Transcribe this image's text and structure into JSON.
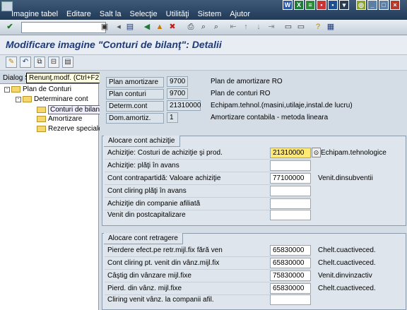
{
  "menu": {
    "items": [
      "Imagine tabel",
      "Editare",
      "Salt la",
      "Selecţie",
      "Utilităţi",
      "Sistem",
      "Ajutor"
    ]
  },
  "title": "Modificare imagine \"Conturi de bilanţ\": Detalii",
  "tooltip": "Renunţ.modf.  (Ctrl+F2)",
  "left": {
    "dialog_label": "Dialog S",
    "tree": [
      {
        "label": "Plan de Conturi",
        "level": 0
      },
      {
        "label": "Determinare cont",
        "level": 1
      },
      {
        "label": "Conturi de bilanţ",
        "level": 2
      },
      {
        "label": "Amortizare",
        "level": 2
      },
      {
        "label": "Rezerve speciale",
        "level": 2
      }
    ]
  },
  "header": {
    "plan_amort_label": "Plan amortizare",
    "plan_amort_value": "9700",
    "plan_amort_desc": "Plan de amortizare RO",
    "plan_conturi_label": "Plan conturi",
    "plan_conturi_value": "9700",
    "plan_conturi_desc": "Plan de conturi RO",
    "determ_label": "Determ.cont",
    "determ_value": "21310000",
    "determ_desc": "Echipam.tehnol.(masini,utilaje,instal.de lucru)",
    "dom_label": "Dom.amortiz.",
    "dom_value": "1",
    "dom_desc": "Amortizare contabila - metoda lineara"
  },
  "group1": {
    "title": "Alocare cont achiziţie",
    "rows": [
      {
        "label": "Achiziţie: Costuri de achiziţie şi prod.",
        "value": "21310000",
        "desc": "Echipam.tehnologice"
      },
      {
        "label": "Achiziţie: plăţi în avans",
        "value": "",
        "desc": ""
      },
      {
        "label": "Cont contrapartidă: Valoare achiziţie",
        "value": "77100000",
        "desc": "Venit.dinsubventii"
      },
      {
        "label": "Cont cliring plăţi în avans",
        "value": "",
        "desc": ""
      },
      {
        "label": "Achiziţie din companie afiliată",
        "value": "",
        "desc": ""
      },
      {
        "label": "Venit din postcapitalizare",
        "value": "",
        "desc": ""
      }
    ]
  },
  "group2": {
    "title": "Alocare cont retragere",
    "rows": [
      {
        "label": "Pierdere efect.pe retr.mijl.fix fără ven",
        "value": "65830000",
        "desc": "Chelt.cuactiveced."
      },
      {
        "label": "Cont cliring pt. venit din vânz.mijl.fix",
        "value": "65830000",
        "desc": "Chelt.cuactiveced."
      },
      {
        "label": "Câştig din vânzare mijl.fixe",
        "value": "75830000",
        "desc": "Venit.dinvinzactiv"
      },
      {
        "label": "Pierd. din vânz. mijl.fixe",
        "value": "65830000",
        "desc": "Chelt.cuactiveced."
      },
      {
        "label": "Cliring venit vânz. la companii afil.",
        "value": "",
        "desc": ""
      }
    ]
  },
  "icons": {
    "enter": "check-icon",
    "save": "save-icon",
    "back": "back-icon",
    "exit": "exit-icon",
    "cancel": "cancel-icon",
    "print": "print-icon",
    "help": "help-icon"
  }
}
